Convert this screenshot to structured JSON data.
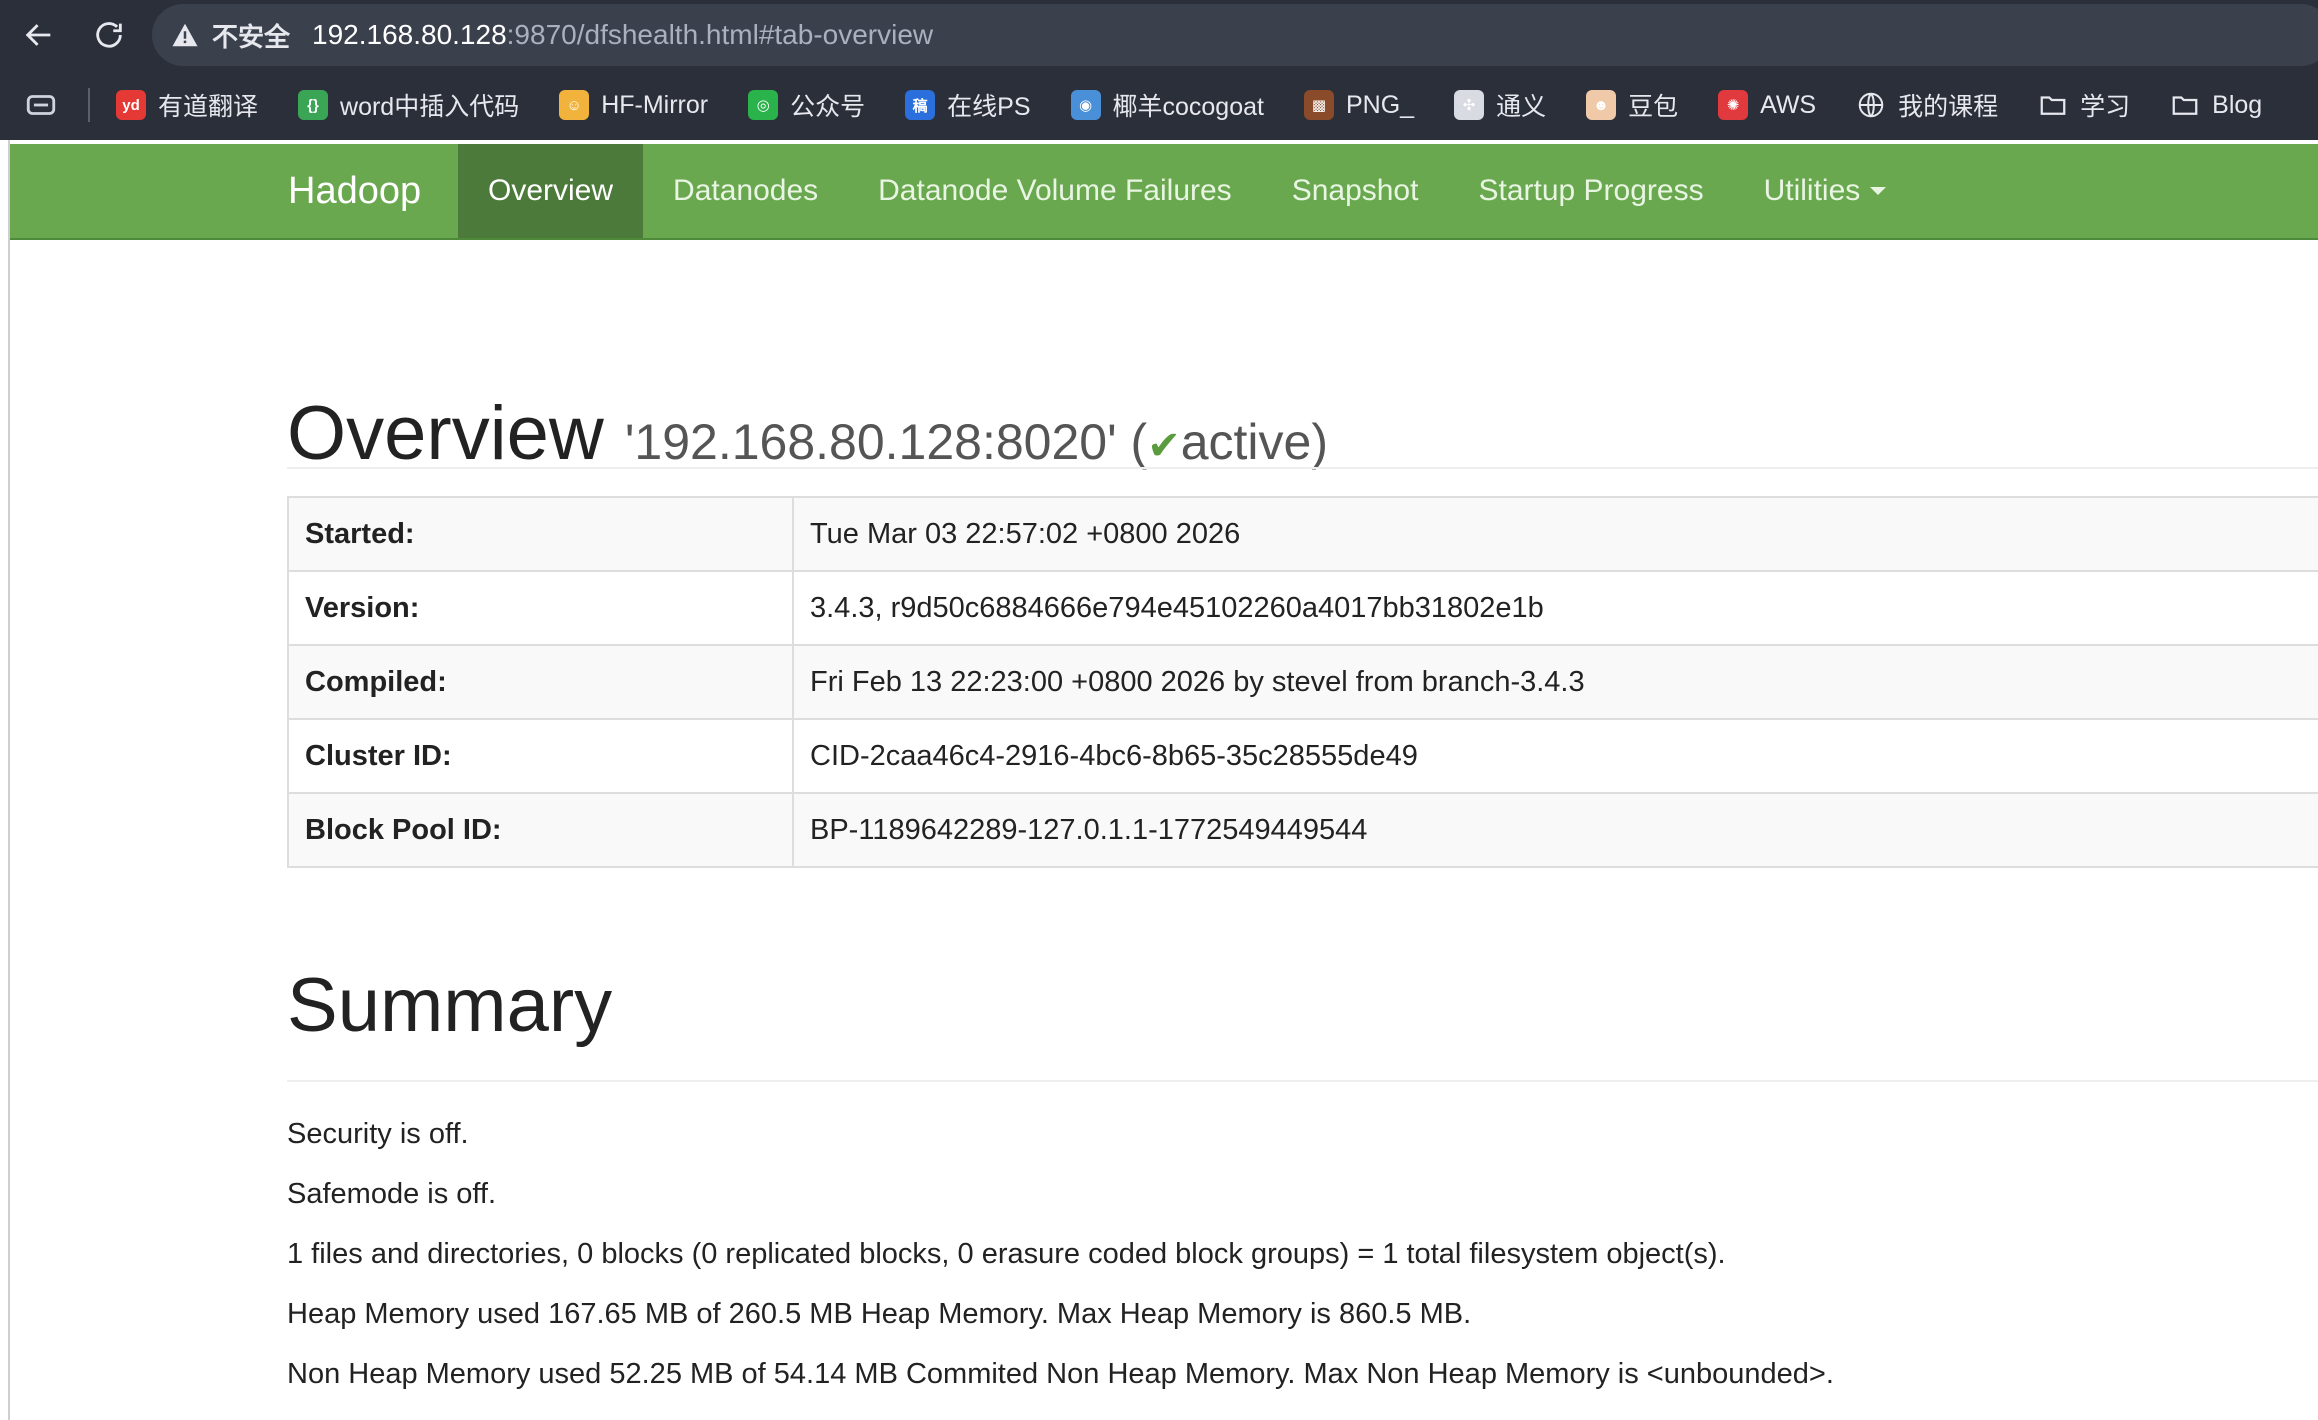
{
  "browser": {
    "security_label": "不安全",
    "url_host": "192.168.80.128",
    "url_rest": ":9870/dfshealth.html#tab-overview",
    "bookmarks": [
      {
        "label": "有道翻译",
        "icon": "youdao-icon",
        "color": "#e53935",
        "glyph": "yd"
      },
      {
        "label": "word中插入代码",
        "icon": "code-braces-icon",
        "color": "#3aa655",
        "glyph": "{}"
      },
      {
        "label": "HF-Mirror",
        "icon": "hugging-face-icon",
        "color": "#f2b33d",
        "glyph": "☺"
      },
      {
        "label": "公众号",
        "icon": "wechat-icon",
        "color": "#2ab24b",
        "glyph": "◎"
      },
      {
        "label": "在线PS",
        "icon": "photopea-icon",
        "color": "#2a6fdb",
        "glyph": "稿"
      },
      {
        "label": "椰羊cocogoat",
        "icon": "cocogoat-icon",
        "color": "#4a90d9",
        "glyph": "◉"
      },
      {
        "label": "PNG_",
        "icon": "png-icon",
        "color": "#8a4b2a",
        "glyph": "▩"
      },
      {
        "label": "通义",
        "icon": "tongyi-icon",
        "color": "#d9dbe3",
        "glyph": "✣"
      },
      {
        "label": "豆包",
        "icon": "doubao-icon",
        "color": "#f0c9a8",
        "glyph": "☻"
      },
      {
        "label": "AWS",
        "icon": "aws-icon",
        "color": "#e0393e",
        "glyph": "✺"
      },
      {
        "label": "我的课程",
        "icon": "globe-icon",
        "color": "",
        "glyph": ""
      },
      {
        "label": "学习",
        "icon": "folder-icon",
        "color": "",
        "glyph": ""
      },
      {
        "label": "Blog",
        "icon": "folder-icon",
        "color": "",
        "glyph": ""
      }
    ]
  },
  "navbar": {
    "brand": "Hadoop",
    "items": [
      {
        "label": "Overview",
        "active": true
      },
      {
        "label": "Datanodes",
        "active": false
      },
      {
        "label": "Datanode Volume Failures",
        "active": false
      },
      {
        "label": "Snapshot",
        "active": false
      },
      {
        "label": "Startup Progress",
        "active": false
      },
      {
        "label": "Utilities",
        "active": false
      }
    ],
    "colors": {
      "bar": "#6aa84f",
      "active": "#4c7a3a"
    }
  },
  "overview": {
    "title": "Overview",
    "address": "'192.168.80.128:8020'",
    "paren_open": " (",
    "state": "active",
    "paren_close": ")",
    "rows": [
      {
        "key": "Started:",
        "value": "Tue Mar 03 22:57:02 +0800 2026"
      },
      {
        "key": "Version:",
        "value": "3.4.3, r9d50c6884666e794e45102260a4017bb31802e1b"
      },
      {
        "key": "Compiled:",
        "value": "Fri Feb 13 22:23:00 +0800 2026 by stevel from branch-3.4.3"
      },
      {
        "key": "Cluster ID:",
        "value": "CID-2caa46c4-2916-4bc6-8b65-35c28555de49"
      },
      {
        "key": "Block Pool ID:",
        "value": "BP-1189642289-127.0.1.1-1772549449544"
      }
    ]
  },
  "summary": {
    "title": "Summary",
    "lines": [
      "Security is off.",
      "Safemode is off.",
      "1 files and directories, 0 blocks (0 replicated blocks, 0 erasure coded block groups) = 1 total filesystem object(s).",
      "Heap Memory used 167.65 MB of 260.5 MB Heap Memory. Max Heap Memory is 860.5 MB.",
      "Non Heap Memory used 52.25 MB of 54.14 MB Commited Non Heap Memory. Max Non Heap Memory is <unbounded>."
    ]
  }
}
